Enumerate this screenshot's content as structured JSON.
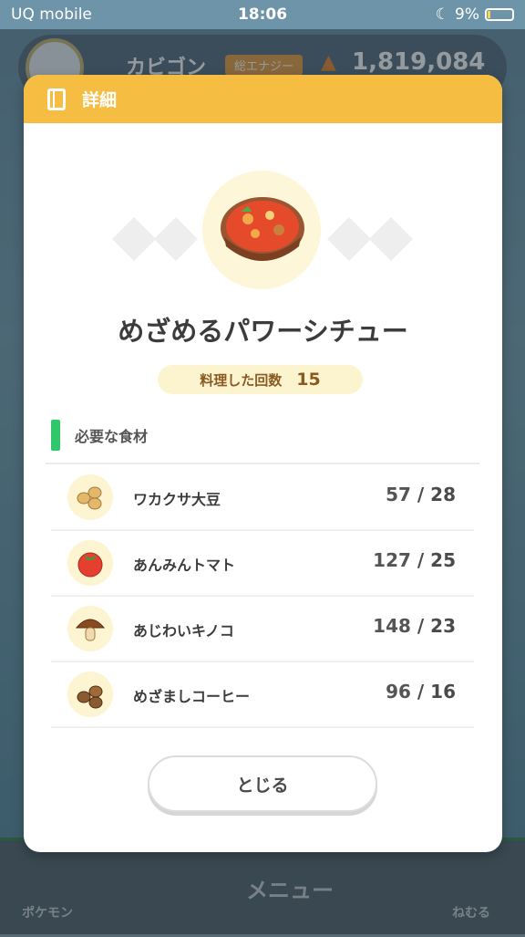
{
  "status_bar": {
    "carrier": "UQ mobile",
    "time": "18:06",
    "battery": "9%"
  },
  "background": {
    "pokemon_name": "カビゴン",
    "energy_label": "総エナジー",
    "energy_value": "1,819,084",
    "nav_pokemon": "ポケモン",
    "nav_menu": "メニュー",
    "nav_sleep": "ねむる"
  },
  "modal": {
    "title": "詳細",
    "dish_name": "めざめるパワーシチュー",
    "cook_count_label": "料理した回数",
    "cook_count": "15",
    "ingredients_title": "必要な食材",
    "ingredients": [
      {
        "name": "ワカクサ大豆",
        "have": "57",
        "need": "28",
        "icon": "soybean-icon"
      },
      {
        "name": "あんみんトマト",
        "have": "127",
        "need": "25",
        "icon": "tomato-icon"
      },
      {
        "name": "あじわいキノコ",
        "have": "148",
        "need": "23",
        "icon": "mushroom-icon"
      },
      {
        "name": "めざましコーヒー",
        "have": "96",
        "need": "16",
        "icon": "coffee-icon"
      }
    ],
    "close_label": "とじる"
  },
  "colors": {
    "header": "#f6bd43",
    "accent_green": "#2fc76a",
    "pill_bg": "#fcf4cf",
    "count_text": "#8a5a22"
  }
}
